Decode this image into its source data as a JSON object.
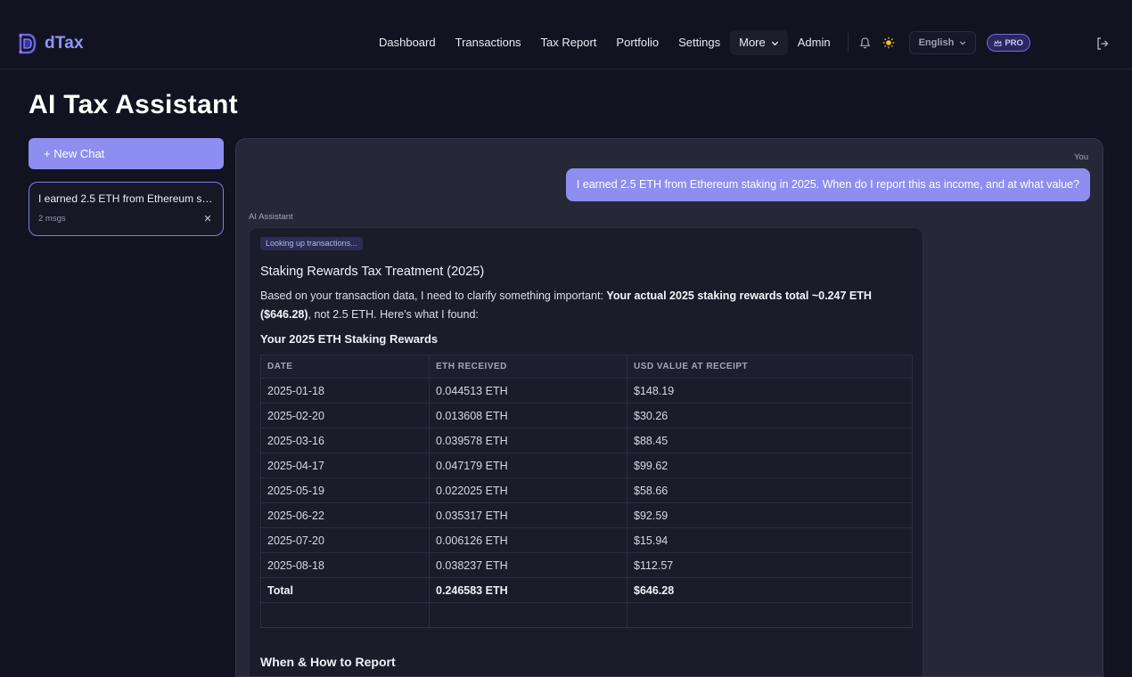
{
  "app": {
    "name": "dTax"
  },
  "nav": {
    "items": [
      "Dashboard",
      "Transactions",
      "Tax Report",
      "Portfolio",
      "Settings"
    ],
    "more": "More",
    "admin": "Admin",
    "language": "English",
    "pro_badge": "PRO"
  },
  "page": {
    "title": "AI Tax Assistant"
  },
  "sidebar": {
    "new_chat_label": "+ New Chat",
    "chats": [
      {
        "title": "I earned 2.5 ETH from Ethereum sta...",
        "meta": "2 msgs"
      }
    ]
  },
  "chat": {
    "user_label": "You",
    "user_message": "I earned 2.5 ETH from Ethereum staking in 2025. When do I report this as income, and at what value?",
    "assistant_label": "AI Assistant",
    "lookup_badge": "Looking up transactions...",
    "response_title": "Staking Rewards Tax Treatment (2025)",
    "response_intro_1": "Based on your transaction data, I need to clarify something important: ",
    "response_intro_bold": "Your actual 2025 staking rewards total ~0.247 ETH ($646.28)",
    "response_intro_2": ", not 2.5 ETH. Here's what I found:",
    "table_title": "Your 2025 ETH Staking Rewards",
    "table": {
      "headers": [
        "DATE",
        "ETH RECEIVED",
        "USD VALUE AT RECEIPT"
      ],
      "rows": [
        [
          "2025-01-18",
          "0.044513 ETH",
          "$148.19"
        ],
        [
          "2025-02-20",
          "0.013608 ETH",
          "$30.26"
        ],
        [
          "2025-03-16",
          "0.039578 ETH",
          "$88.45"
        ],
        [
          "2025-04-17",
          "0.047179 ETH",
          "$99.62"
        ],
        [
          "2025-05-19",
          "0.022025 ETH",
          "$58.66"
        ],
        [
          "2025-06-22",
          "0.035317 ETH",
          "$92.59"
        ],
        [
          "2025-07-20",
          "0.006126 ETH",
          "$15.94"
        ],
        [
          "2025-08-18",
          "0.038237 ETH",
          "$112.57"
        ]
      ],
      "total": [
        "Total",
        "0.246583 ETH",
        "$646.28"
      ]
    },
    "next_heading": "When & How to Report"
  },
  "colors": {
    "accent": "#8d8ef0",
    "background": "#121320",
    "panel": "#262838"
  }
}
